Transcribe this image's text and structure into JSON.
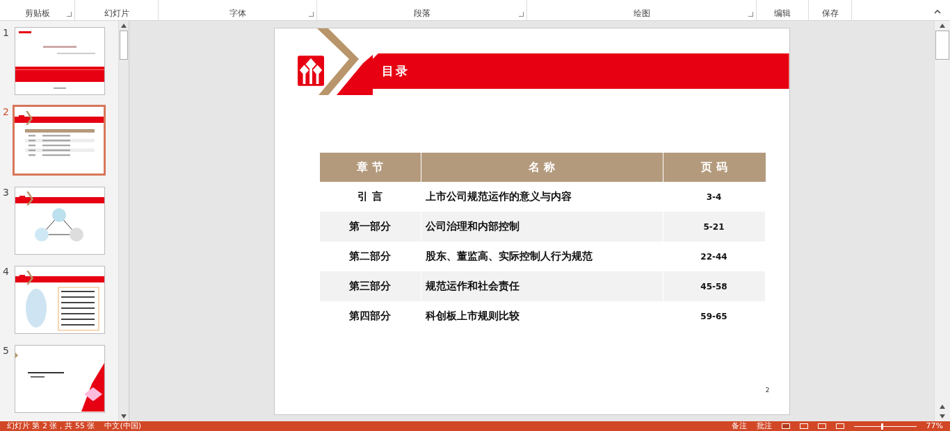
{
  "ribbon": {
    "groups": [
      {
        "label": "剪贴板",
        "launcher": true
      },
      {
        "label": "幻灯片",
        "launcher": false
      },
      {
        "label": "字体",
        "launcher": true
      },
      {
        "label": "段落",
        "launcher": true
      },
      {
        "label": "绘图",
        "launcher": true
      },
      {
        "label": "编辑",
        "launcher": false
      },
      {
        "label": "保存",
        "launcher": false
      }
    ]
  },
  "thumbnails": [
    {
      "number": "1",
      "kind": "title",
      "selected": false
    },
    {
      "number": "2",
      "kind": "table",
      "selected": true
    },
    {
      "number": "3",
      "kind": "diagram",
      "selected": false
    },
    {
      "number": "4",
      "kind": "list",
      "selected": false
    },
    {
      "number": "5",
      "kind": "section",
      "selected": false
    }
  ],
  "slide": {
    "title": "目录",
    "page_number": "2",
    "table": {
      "columns": [
        "章 节",
        "名 称",
        "页 码"
      ],
      "rows": [
        [
          "引 言",
          "上市公司规范运作的意义与内容",
          "3-4"
        ],
        [
          "第一部分",
          "公司治理和内部控制",
          "5-21"
        ],
        [
          "第二部分",
          "股东、董监高、实际控制人行为规范",
          "22-44"
        ],
        [
          "第三部分",
          "规范运作和社会责任",
          "45-58"
        ],
        [
          "第四部分",
          "科创板上市规则比较",
          "59-65"
        ]
      ]
    }
  },
  "status_bar": {
    "slide_info": "幻灯片 第 2 张，共 55 张",
    "language": "中文(中国)",
    "notes": "备注",
    "comments": "批注",
    "zoom": "77%",
    "zoom_slider": {
      "level": 0.45
    }
  }
}
